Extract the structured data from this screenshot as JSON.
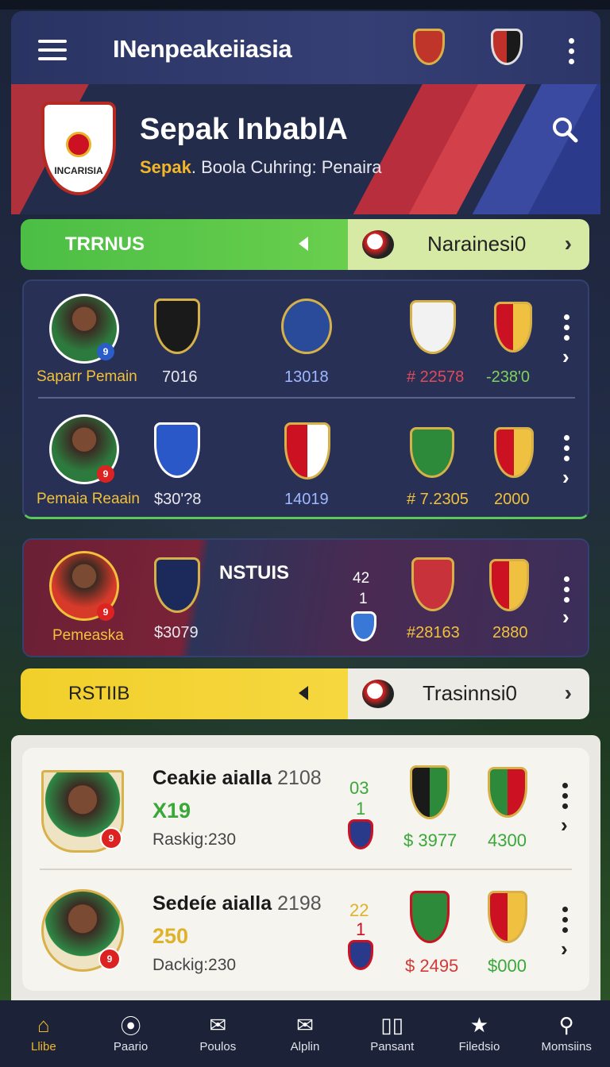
{
  "app": {
    "title": "INenpeakeiiasia"
  },
  "header": {
    "crest_text": "INCARISIA",
    "title": "Sepak InbablA",
    "subtitle_accent": "Sepak",
    "subtitle_rest": "Boola Cuhring: Penaira"
  },
  "bar1": {
    "left_label": "TRRNUS",
    "right_label": "Narainesi0"
  },
  "bar2": {
    "left_label": "RSTIIB",
    "right_label": "Trasinnsi0"
  },
  "card1": {
    "rows": [
      {
        "player": "Saparr Pemain",
        "v1": "7016",
        "v2": "13018",
        "v3": "# 22578",
        "v4": "-238'0"
      },
      {
        "player": "Pemaia Reaain",
        "v1": "$30'?8",
        "v2": "14019",
        "v3": "# 7.2305",
        "v4": "2000"
      }
    ]
  },
  "card2": {
    "player": "Pemeaska",
    "v1": "$3079",
    "label": "NSTUIS",
    "small_top": "42",
    "small_bottom": "1",
    "v3": "#28163",
    "v4": "2880"
  },
  "list": [
    {
      "name": "Ceakie aialla",
      "year": "2108",
      "value": "X19",
      "rank": "Raskig:230",
      "top": "03",
      "bottom": "1",
      "n1": "$ 3977",
      "n2": "4300",
      "badge": "9"
    },
    {
      "name": "Sedeíe aialla",
      "year": "2198",
      "value": "250",
      "rank": "Dackig:230",
      "top": "22",
      "bottom": "1",
      "n1": "$ 2495",
      "n2": "$000",
      "badge": "9"
    }
  ],
  "nav": [
    {
      "label": "Llibe",
      "icon": "home-icon"
    },
    {
      "label": "Paario",
      "icon": "location-pin-icon"
    },
    {
      "label": "Poulos",
      "icon": "mail-icon"
    },
    {
      "label": "Alplin",
      "icon": "envelope-icon"
    },
    {
      "label": "Pansant",
      "icon": "book-icon"
    },
    {
      "label": "Filedsio",
      "icon": "star-icon"
    },
    {
      "label": "Momsiins",
      "icon": "user-search-icon"
    }
  ],
  "colors": {
    "accent_gold": "#f1b62a",
    "green_bar": "#4bbe45",
    "yellow_bar": "#f1cf2b",
    "red_value": "#e24a5a",
    "green_value": "#7fd35a"
  }
}
